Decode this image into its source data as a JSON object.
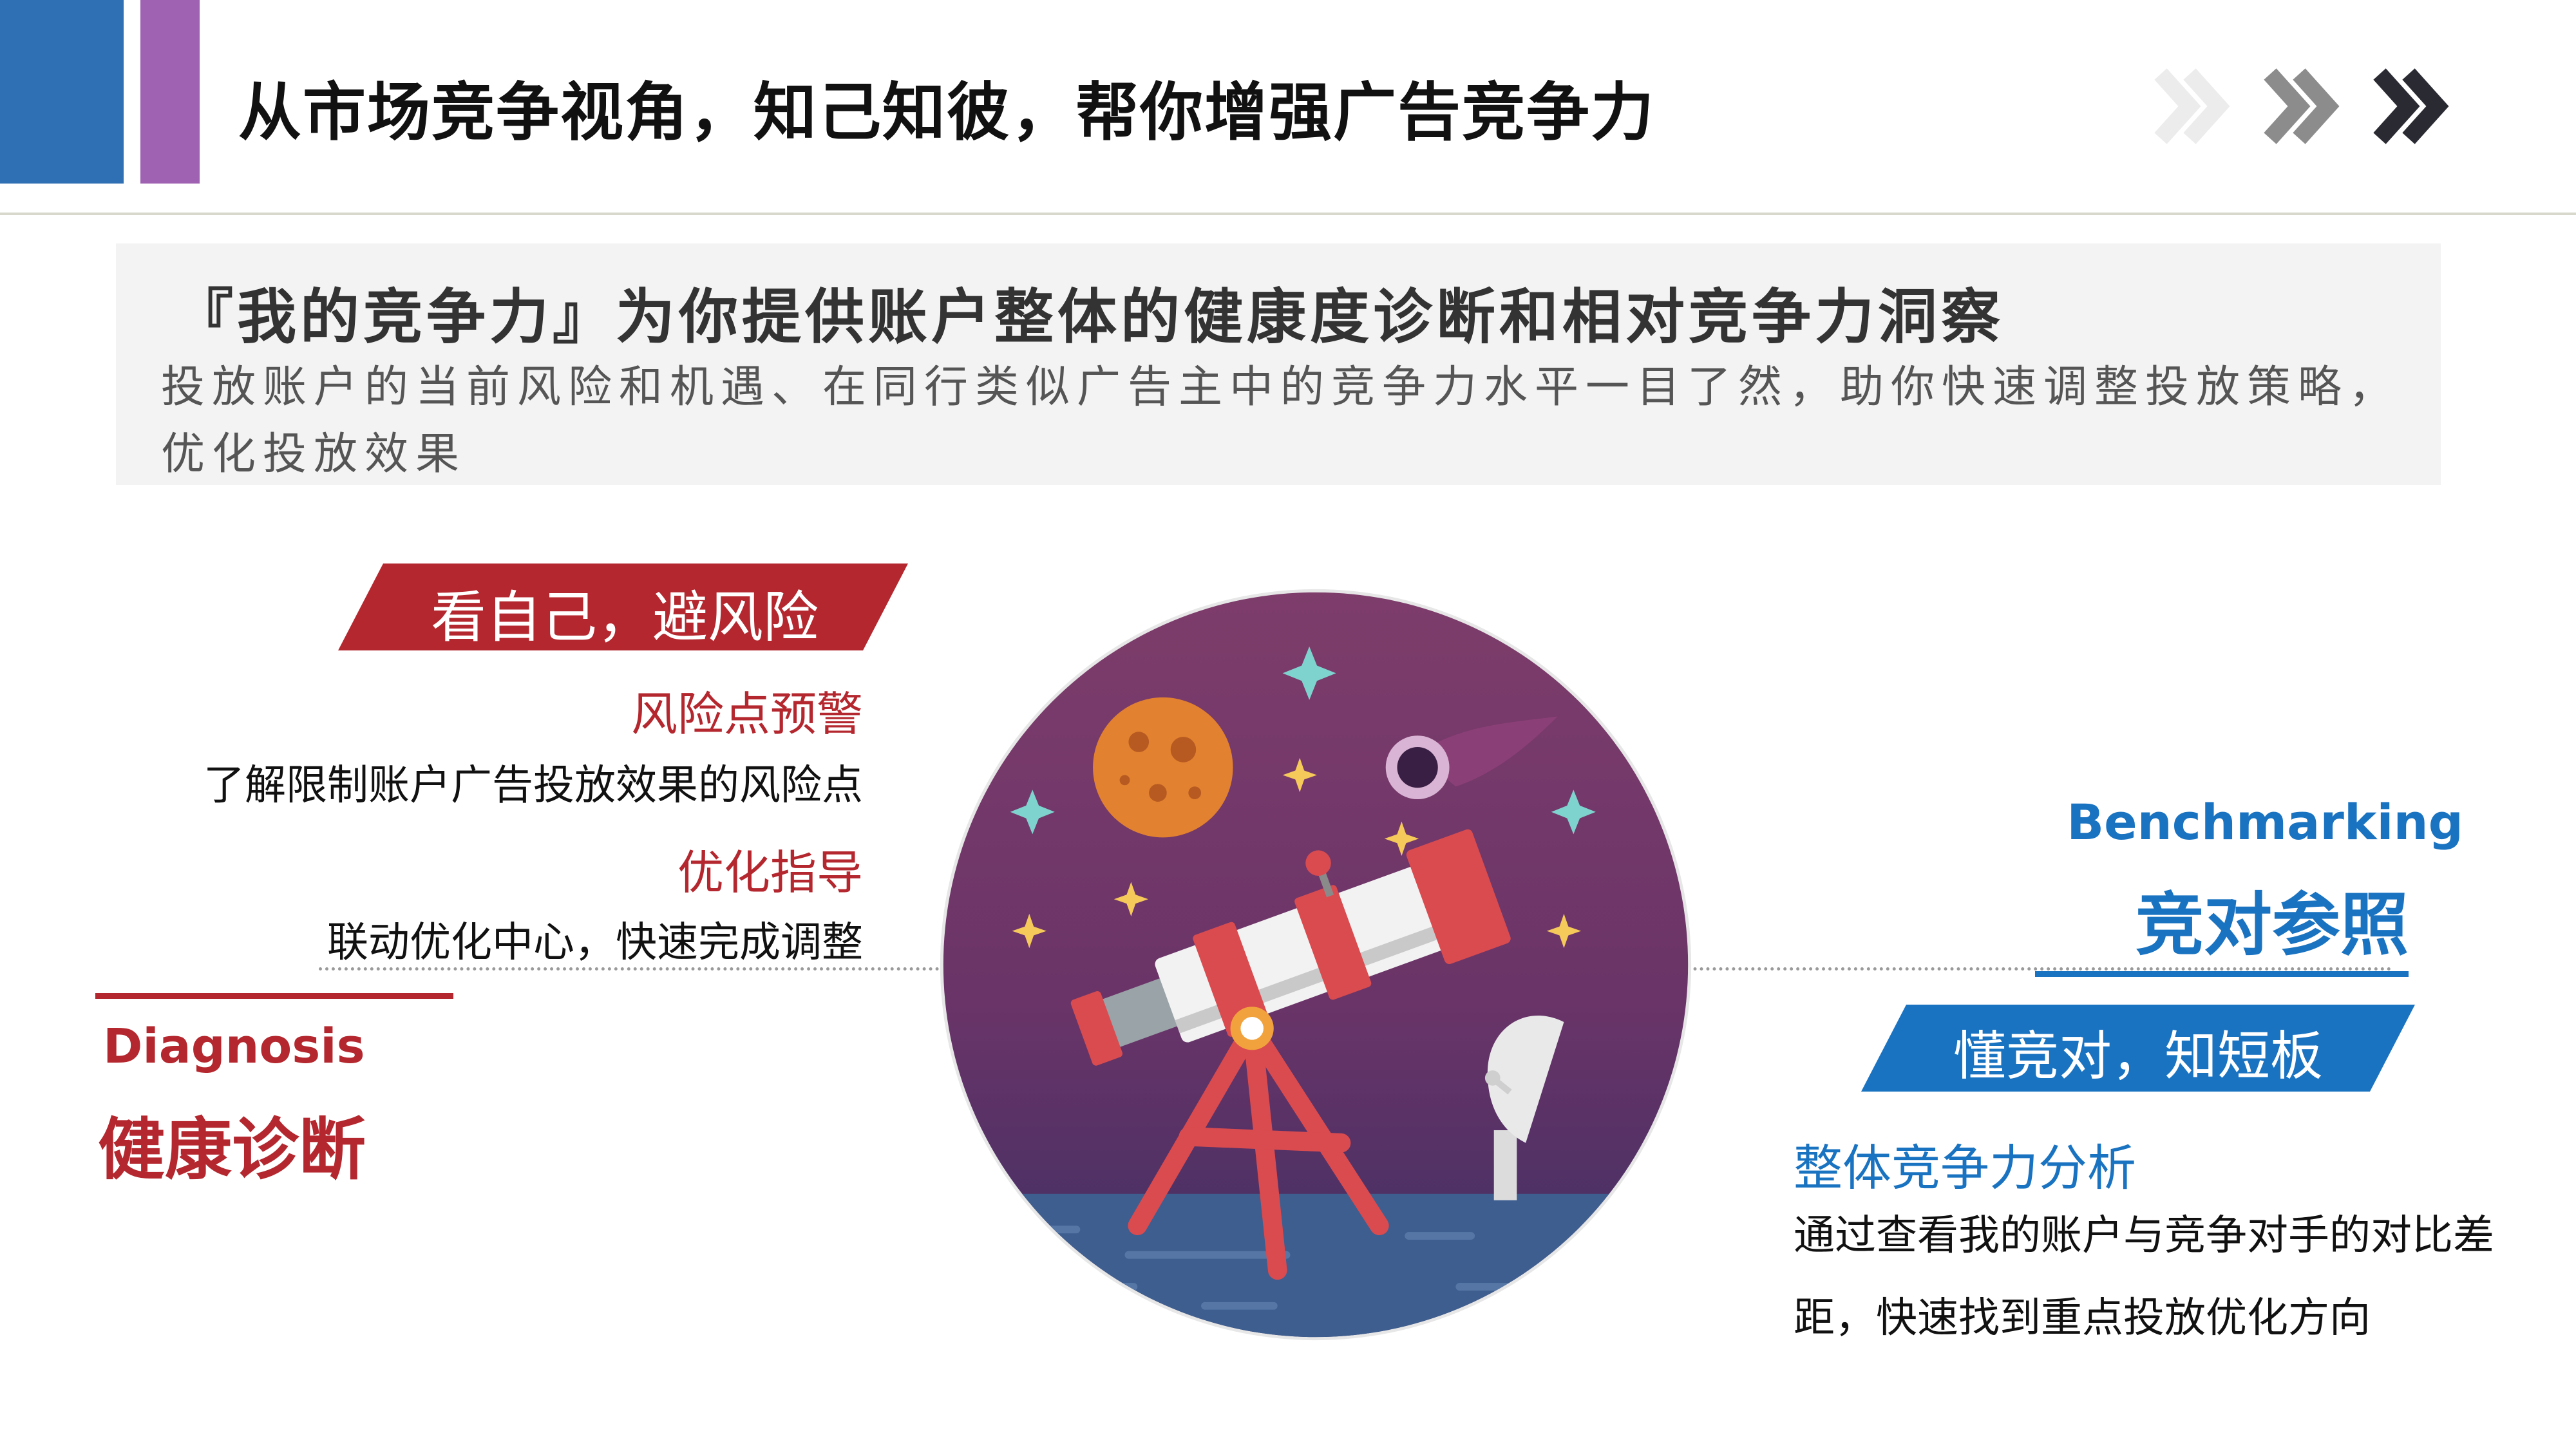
{
  "header": {
    "title": "从市场竞争视角，知己知彼，帮你增强广告竞争力",
    "nav_icon": "chevron-double-right-icon"
  },
  "intro": {
    "title": "『我的竞争力』为你提供账户整体的健康度诊断和相对竞争力洞察",
    "text": "投放账户的当前风险和机遇、在同行类似广告主中的竞争力水平一目了然，助你快速调整投放策略，优化投放效果"
  },
  "left": {
    "banner": "看自己，避风险",
    "items": [
      {
        "heading": "风险点预警",
        "text": "了解限制账户广告投放效果的风险点"
      },
      {
        "heading": "优化指导",
        "text": "联动优化中心，快速完成调整"
      }
    ],
    "title_en": "Diagnosis",
    "title_cn": "健康诊断"
  },
  "right": {
    "title_en": "Benchmarking",
    "title_cn": "竞对参照",
    "banner": "懂竞对，知短板",
    "item": {
      "heading": "整体竞争力分析",
      "text": "通过查看我的账户与竞争对手的对比差距，快速找到重点投放优化方向"
    }
  },
  "colors": {
    "accent_red": "#b4272e",
    "accent_blue": "#1a73c1",
    "header_blue": "#2f6fb3",
    "header_purple": "#9f61b1"
  }
}
